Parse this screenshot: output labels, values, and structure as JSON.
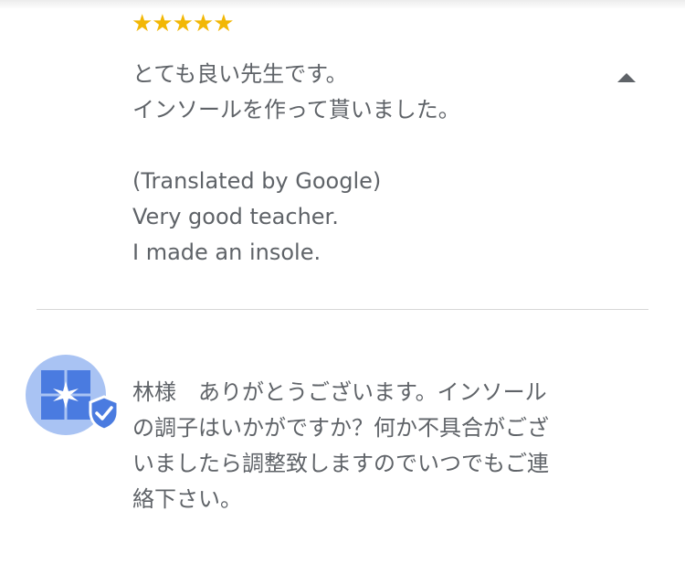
{
  "review": {
    "rating": 5,
    "stars_display": "★★★★★",
    "star_color": "#F2B705",
    "original_lines": [
      "とても良い先生です。",
      "インソールを作って貰いました。"
    ],
    "translated_label": "(Translated by Google)",
    "translated_lines": [
      "Very good teacher.",
      "I made an insole."
    ],
    "collapse_icon": "caret-up-icon"
  },
  "owner_reply": {
    "avatar_icon": "business-logo-icon",
    "verified_icon": "verified-shield-icon",
    "avatar_color": "#A9C3F3",
    "accent_color": "#4A7BE0",
    "lines": [
      "林様　ありがとうございます。インソール",
      "の調子はいかがですか？何か不具合がござ",
      "いましたら調整致しますのでいつでもご連",
      "絡下さい。"
    ]
  },
  "colors": {
    "text": "#5F6368",
    "divider": "#D7D7D7"
  }
}
